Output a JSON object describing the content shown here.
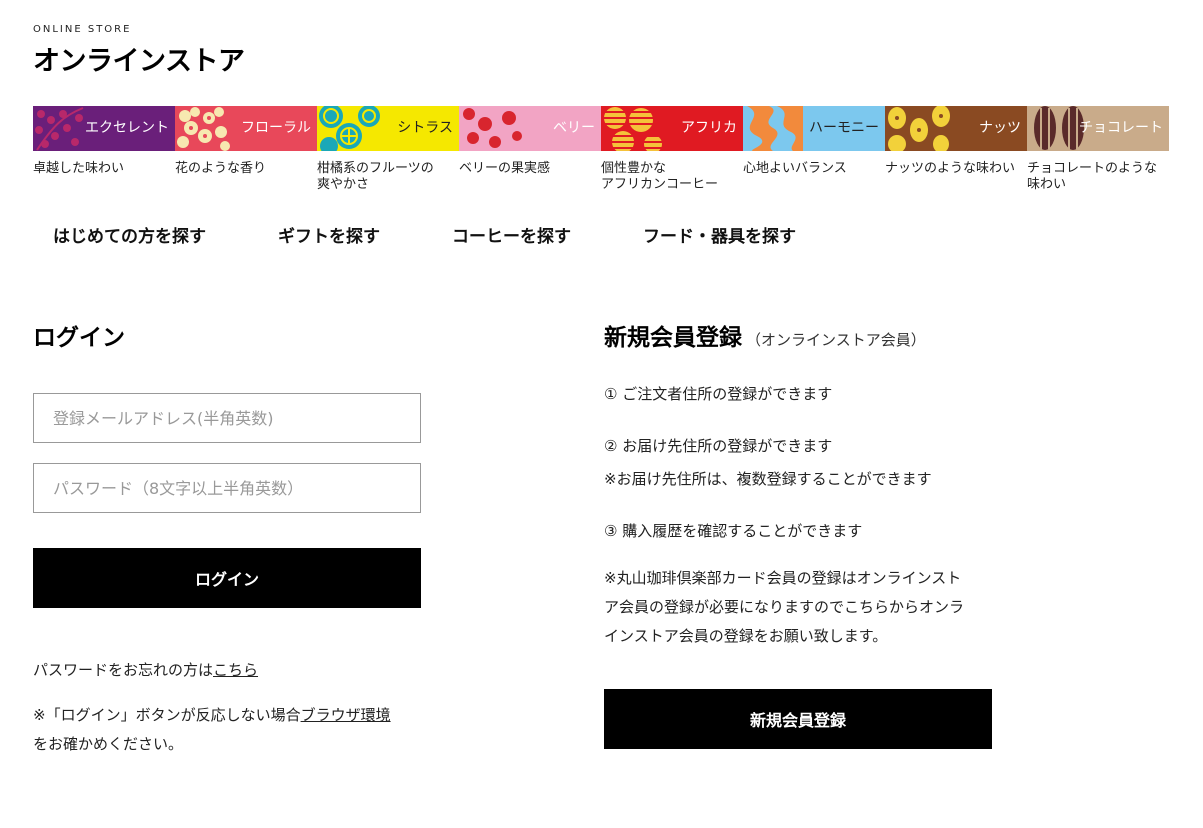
{
  "header": {
    "store_en": "ONLINE STORE",
    "store_ja": "オンラインストア"
  },
  "categories": [
    {
      "name": "エクセレント",
      "desc": "卓越した味わい",
      "bg": "#6a1f7a",
      "fg": "#b8286a",
      "icon": "cherry-branch-icon",
      "dark": false
    },
    {
      "name": "フローラル",
      "desc": "花のような香り",
      "bg": "#e8485a",
      "fg": "#f7e8b0",
      "icon": "flower-icon",
      "dark": false
    },
    {
      "name": "シトラス",
      "desc": "柑橘系のフルーツの\n爽やかさ",
      "bg": "#f5e800",
      "fg": "#1aa8b8",
      "icon": "citrus-slice-icon",
      "dark": true
    },
    {
      "name": "ベリー",
      "desc": "ベリーの果実感",
      "bg": "#f2a4c4",
      "fg": "#d8252e",
      "icon": "berry-icon",
      "dark": false
    },
    {
      "name": "アフリカ",
      "desc": "個性豊かな\nアフリカンコーヒー",
      "bg": "#e01a22",
      "fg": "#f5c23a",
      "icon": "striped-circle-icon",
      "dark": false
    },
    {
      "name": "ハーモニー",
      "desc": "心地よいバランス",
      "bg": "#7cc8ee",
      "fg": "#f28a3c",
      "icon": "wave-icon",
      "dark": true
    },
    {
      "name": "ナッツ",
      "desc": "ナッツのような味わい",
      "bg": "#8a4a22",
      "fg": "#f2d13a",
      "icon": "nut-icon",
      "dark": false
    },
    {
      "name": "チョコレート",
      "desc": "チョコレートのような\n味わい",
      "bg": "#c9ab8a",
      "fg": "#5a2a2a",
      "icon": "cocoa-pod-icon",
      "dark": false
    }
  ],
  "nav": [
    "はじめての方を探す",
    "ギフトを探す",
    "コーヒーを探す",
    "フード・器具を探す"
  ],
  "login": {
    "title": "ログイン",
    "email_placeholder": "登録メールアドレス(半角英数)",
    "password_placeholder": "パスワード（8文字以上半角英数）",
    "button": "ログイン",
    "forgot_text": "パスワードをお忘れの方は",
    "forgot_link": "こちら",
    "note_prefix": "※「ログイン」ボタンが反応しない場合",
    "note_link": "ブラウザ環境",
    "note_suffix": "をお確かめください。"
  },
  "register": {
    "title": "新規会員登録",
    "subtitle": "（オンラインストア会員）",
    "item1": "① ご注文者住所の登録ができます",
    "item2": "② お届け先住所の登録ができます",
    "item2_note": "※お届け先住所は、複数登録することができます",
    "item3": "③ 購入履歴を確認することができます",
    "note_line1": "※丸山珈琲倶楽部カード会員の登録はオンラインスト",
    "note_line2": "ア会員の登録が必要になりますのでこちらからオンラ",
    "note_line3": "インストア会員の登録をお願い致します。",
    "button": "新規会員登録"
  }
}
